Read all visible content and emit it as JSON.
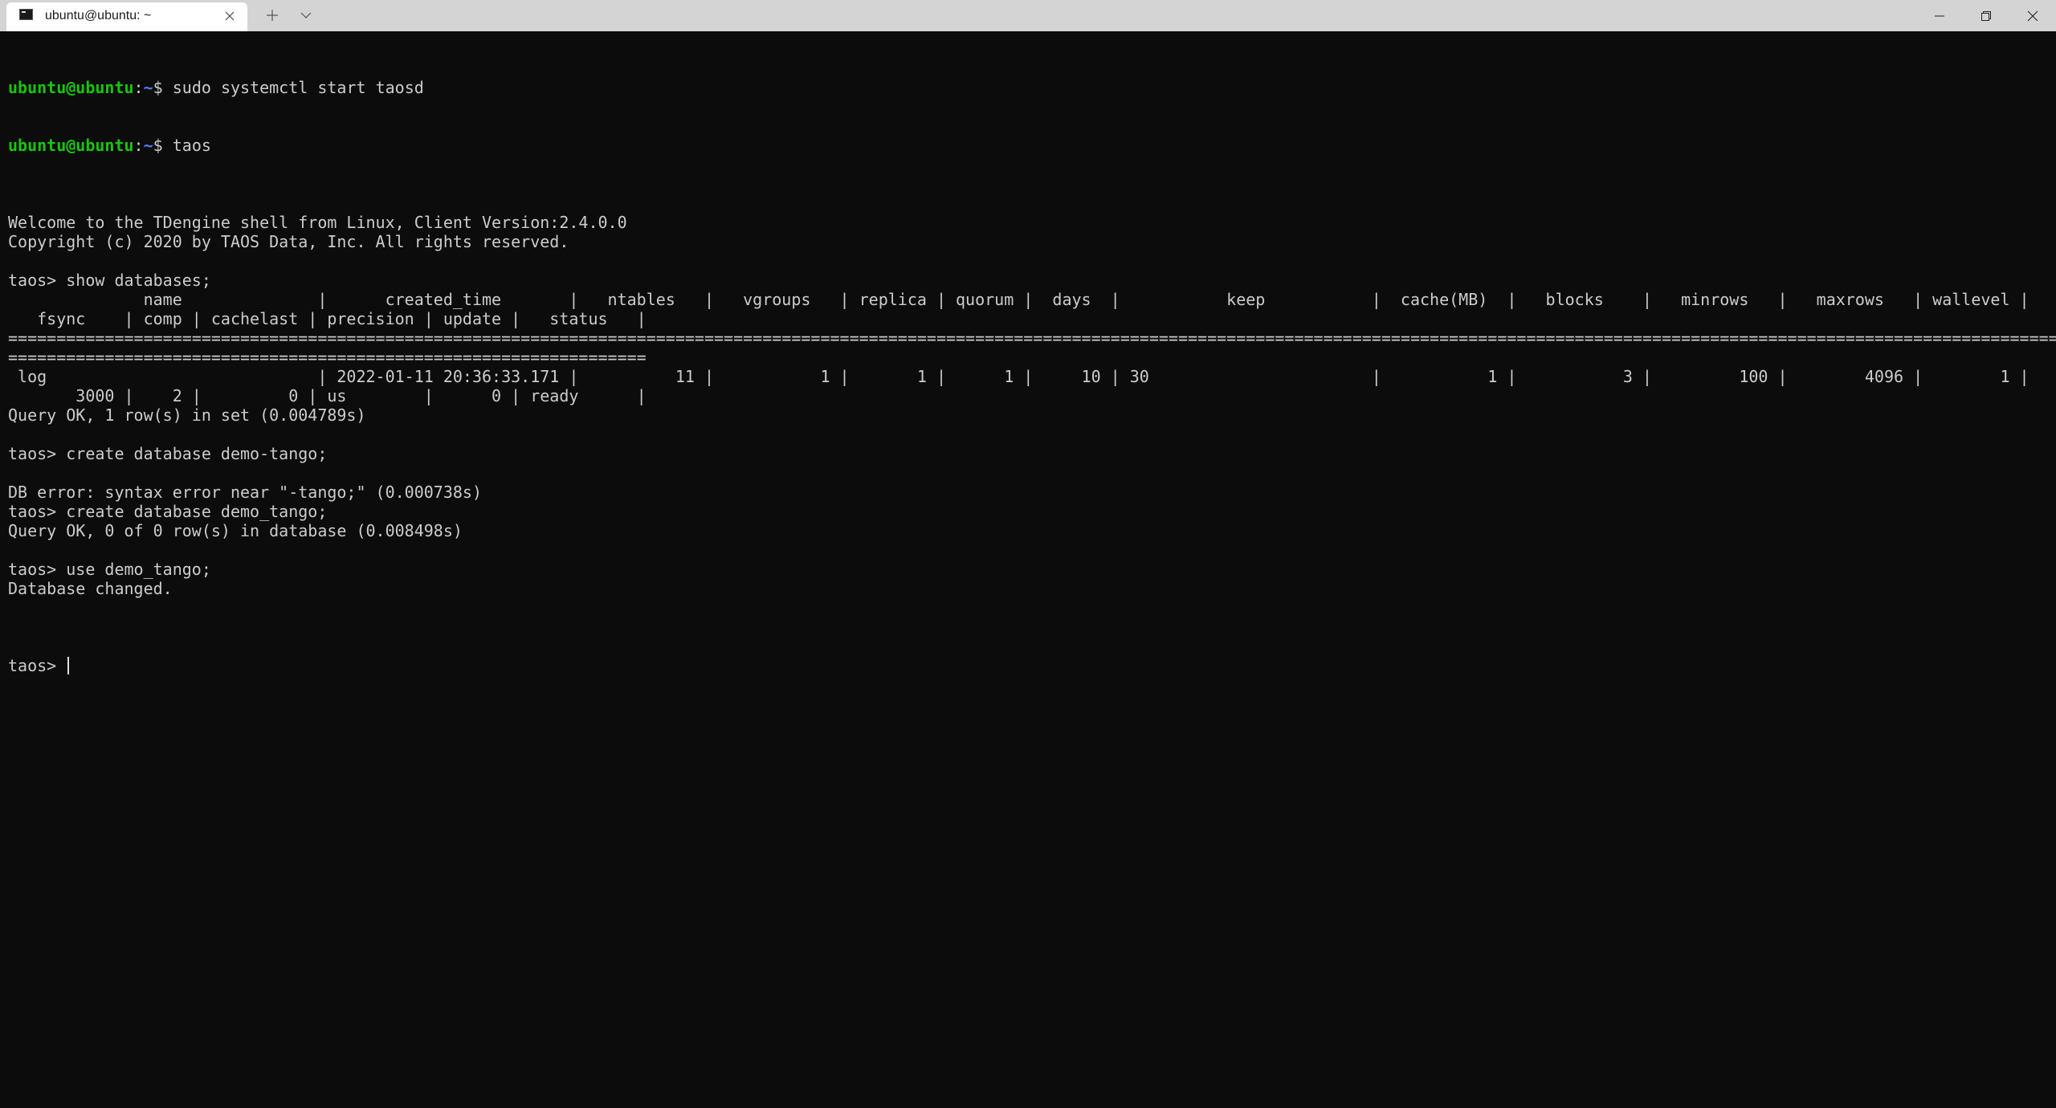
{
  "window": {
    "tab_title": "ubuntu@ubuntu: ~",
    "tab_icon": "terminal-icon",
    "tab_close_icon": "close-icon",
    "new_tab_icon": "plus-icon",
    "dropdown_icon": "chevron-down-icon",
    "controls": {
      "minimize_icon": "minimize-icon",
      "restore_icon": "restore-icon",
      "close_icon": "close-icon"
    }
  },
  "terminal": {
    "colors": {
      "background": "#0c0c0c",
      "text": "#cccccc",
      "prompt_user": "#16c60c",
      "prompt_path": "#4e7ef0"
    },
    "prompt": {
      "user": "ubuntu@ubuntu",
      "colon": ":",
      "path": "~",
      "symbol": "$ "
    },
    "shell_commands": [
      "sudo systemctl start taosd",
      "taos"
    ],
    "lines": [
      "",
      "Welcome to the TDengine shell from Linux, Client Version:2.4.0.0",
      "Copyright (c) 2020 by TAOS Data, Inc. All rights reserved.",
      "",
      "taos> show databases;",
      "              name              |      created_time       |   ntables   |   vgroups   | replica | quorum |  days  |           keep           |  cache(MB)  |   blocks    |   minrows   |   maxrows   | wallevel |",
      "   fsync    | comp | cachelast | precision | update |   status   |",
      "==========================================================================================================================================================================================================================",
      "==================================================================",
      " log                            | 2022-01-11 20:36:33.171 |          11 |           1 |       1 |      1 |     10 | 30                       |           1 |           3 |         100 |        4096 |        1 |",
      "       3000 |    2 |         0 | us        |      0 | ready      |",
      "Query OK, 1 row(s) in set (0.004789s)",
      "",
      "taos> create database demo-tango;",
      "",
      "DB error: syntax error near \"-tango;\" (0.000738s)",
      "taos> create database demo_tango;",
      "Query OK, 0 of 0 row(s) in database (0.008498s)",
      "",
      "taos> use demo_tango;",
      "Database changed.",
      ""
    ],
    "current_prompt": "taos> "
  }
}
